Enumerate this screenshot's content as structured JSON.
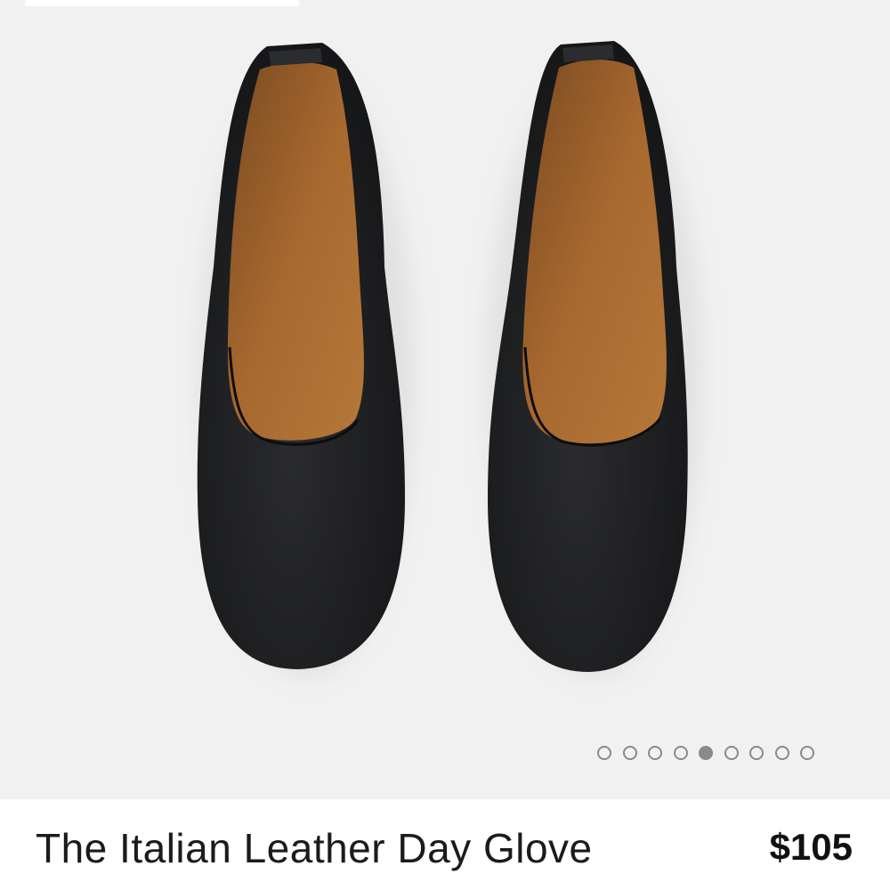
{
  "product": {
    "title": "The Italian Leather Day Glove",
    "price": "$105",
    "image": {
      "subject": "black-leather-flats-pair",
      "colors": {
        "upper": "#1c1d1f",
        "lining": "#9a5f2b",
        "background": "#f1f1f1"
      }
    }
  },
  "carousel": {
    "total": 9,
    "active_index": 4,
    "dot_color": "#8a8a8a"
  }
}
